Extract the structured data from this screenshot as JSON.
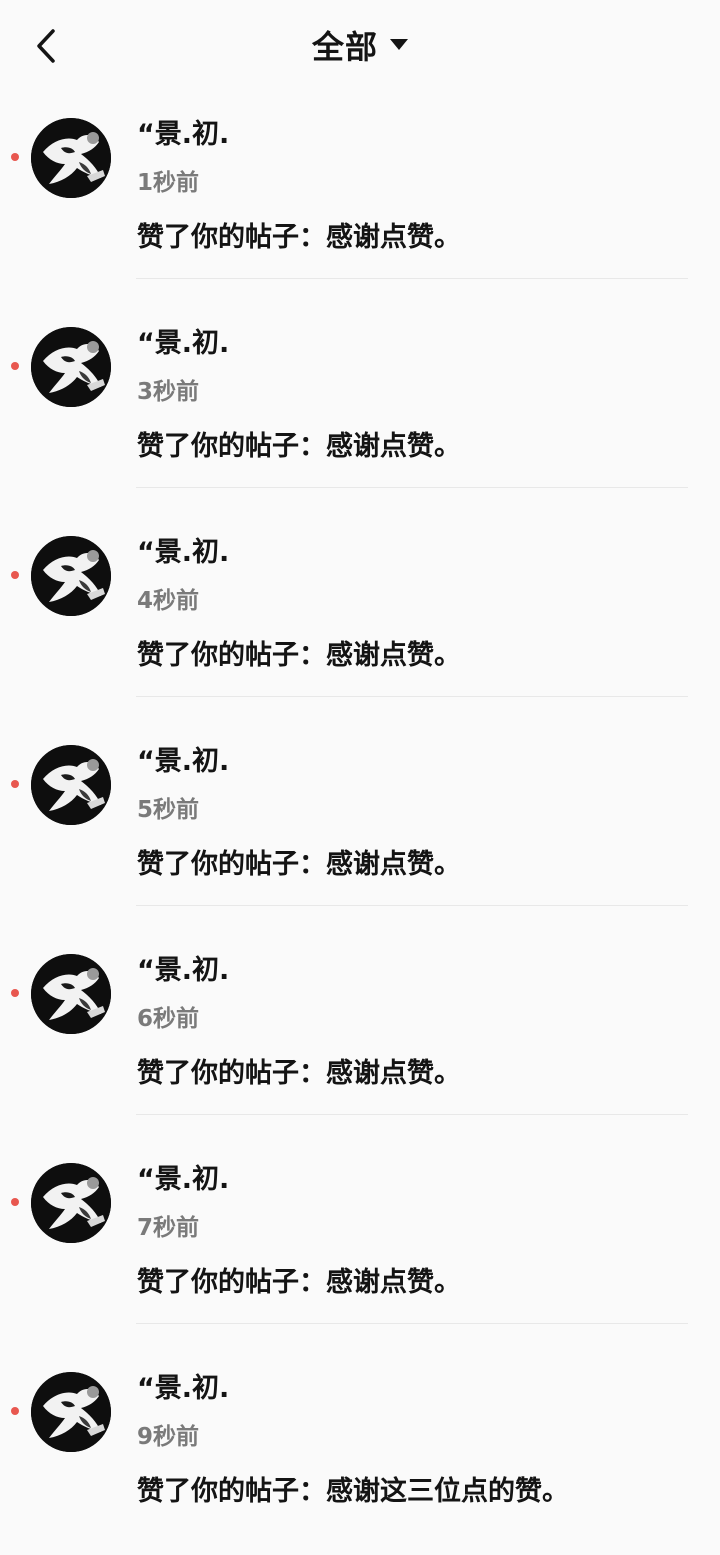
{
  "header": {
    "title": "全部",
    "back_icon": "chevron-left-icon",
    "dropdown_icon": "caret-down-icon"
  },
  "notifications": [
    {
      "user": "“景.初.",
      "time": "1秒前",
      "message": "赞了你的帖子：感谢点赞。",
      "unread": true
    },
    {
      "user": "“景.初.",
      "time": "3秒前",
      "message": "赞了你的帖子：感谢点赞。",
      "unread": true
    },
    {
      "user": "“景.初.",
      "time": "4秒前",
      "message": "赞了你的帖子：感谢点赞。",
      "unread": true
    },
    {
      "user": "“景.初.",
      "time": "5秒前",
      "message": "赞了你的帖子：感谢点赞。",
      "unread": true
    },
    {
      "user": "“景.初.",
      "time": "6秒前",
      "message": "赞了你的帖子：感谢点赞。",
      "unread": true
    },
    {
      "user": "“景.初.",
      "time": "7秒前",
      "message": "赞了你的帖子：感谢点赞。",
      "unread": true
    },
    {
      "user": "“景.初.",
      "time": "9秒前",
      "message": "赞了你的帖子：感谢这三位点的赞。",
      "unread": true
    }
  ],
  "colors": {
    "unread_dot": "#e8574f",
    "time_text": "#7a7a7a",
    "primary_text": "#141414",
    "background": "#fafafa"
  }
}
